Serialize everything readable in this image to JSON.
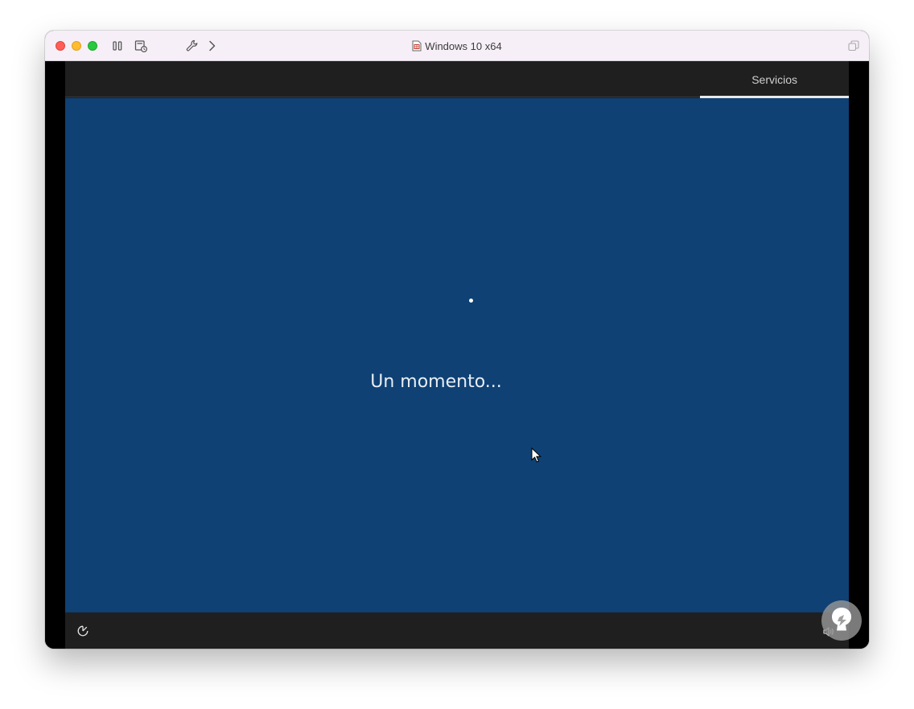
{
  "window": {
    "title": "Windows 10 x64",
    "controls": {
      "close_color": "#ff5f57",
      "minimize_color": "#febc2e",
      "zoom_color": "#28c840"
    },
    "toolbar_icons": [
      "pause-icon",
      "snapshot-icon",
      "settings-wrench-icon",
      "forward-chevron-icon"
    ],
    "right_icon": "restore-window-icon"
  },
  "guest": {
    "top_tab": {
      "label": "Servicios"
    },
    "background_color": "#0f4174",
    "status_message": "Un momento...",
    "bottom_icons": [
      "ease-of-access-icon",
      "volume-icon"
    ]
  }
}
